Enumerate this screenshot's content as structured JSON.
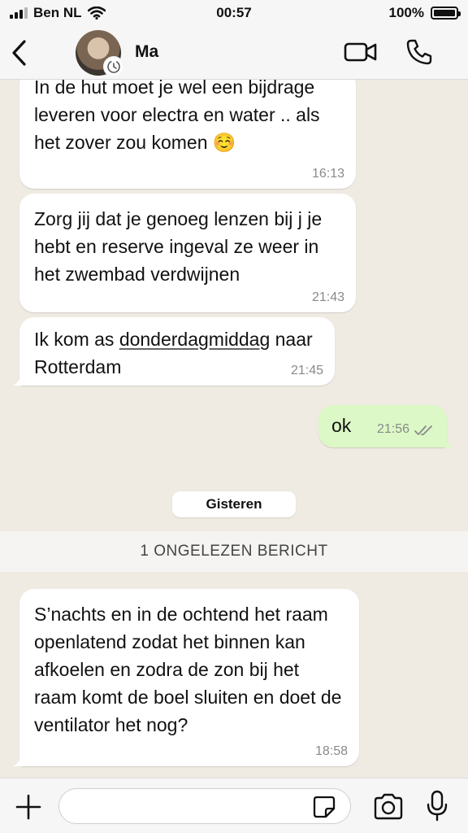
{
  "status_bar": {
    "carrier": "Ben NL",
    "time": "00:57",
    "battery": "100%",
    "battery_level": 1.0
  },
  "header": {
    "contact_name": "Ma",
    "icons": [
      "back-icon",
      "video-call-icon",
      "phone-icon"
    ]
  },
  "messages": [
    {
      "direction": "in",
      "text": "In de hut moet je wel een bijdrage leveren voor electra en water .. als het zover zou komen",
      "emoji": "☺️",
      "time": "16:13"
    },
    {
      "direction": "in",
      "text": "Zorg jij dat je genoeg lenzen bij j je hebt en reserve ingeval ze weer in het zwembad verdwijnen",
      "time": "21:43"
    },
    {
      "direction": "in",
      "text_before": "Ik kom as ",
      "text_link": "donderdagmiddag",
      "text_after": " naar Rotterdam",
      "time": "21:45"
    },
    {
      "direction": "out",
      "text": "ok",
      "time": "21:56",
      "status": "read"
    },
    {
      "direction": "in",
      "text": "S’nachts en in de ochtend het raam openlatend zodat het binnen kan afkoelen en zodra de zon bij het raam komt de boel sluiten en doet de ventilator het nog?",
      "time": "18:58"
    }
  ],
  "date_separator": "Gisteren",
  "unread_banner": "1 ONGELEZEN BERICHT",
  "input": {
    "placeholder": "",
    "value": ""
  },
  "colors": {
    "outgoing_bubble": "#dcf8c6",
    "incoming_bubble": "#ffffff",
    "chat_background": "#efeae2",
    "read_ticks": "#8a8a8a"
  }
}
